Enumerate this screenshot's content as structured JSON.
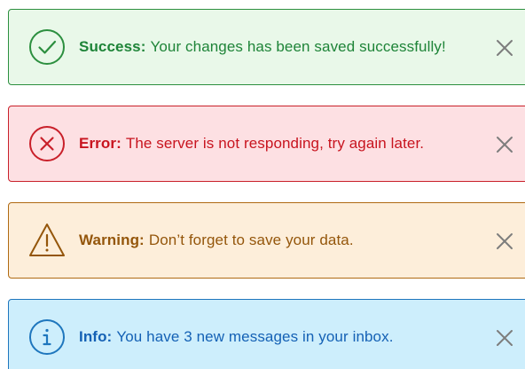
{
  "alerts": [
    {
      "type": "success",
      "label": "Success:",
      "message": "Your changes has been saved successfully!",
      "icon": "check-circle-icon",
      "color": "#1e8438",
      "background": "#e9f8e9",
      "close_icon": "close-icon"
    },
    {
      "type": "error",
      "label": "Error:",
      "message": "The server is not responding, try again later.",
      "icon": "x-circle-icon",
      "color": "#c8141f",
      "background": "#fde0e3",
      "close_icon": "close-icon"
    },
    {
      "type": "warning",
      "label": "Warning:",
      "message": "Don’t forget to save your data.",
      "icon": "warning-triangle-icon",
      "color": "#94560b",
      "background": "#fdeeda",
      "close_icon": "close-icon"
    },
    {
      "type": "info",
      "label": "Info:",
      "message": "You have 3 new messages in your inbox.",
      "icon": "info-circle-icon",
      "color": "#1461b5",
      "background": "#cdeefc",
      "close_icon": "close-icon"
    }
  ]
}
